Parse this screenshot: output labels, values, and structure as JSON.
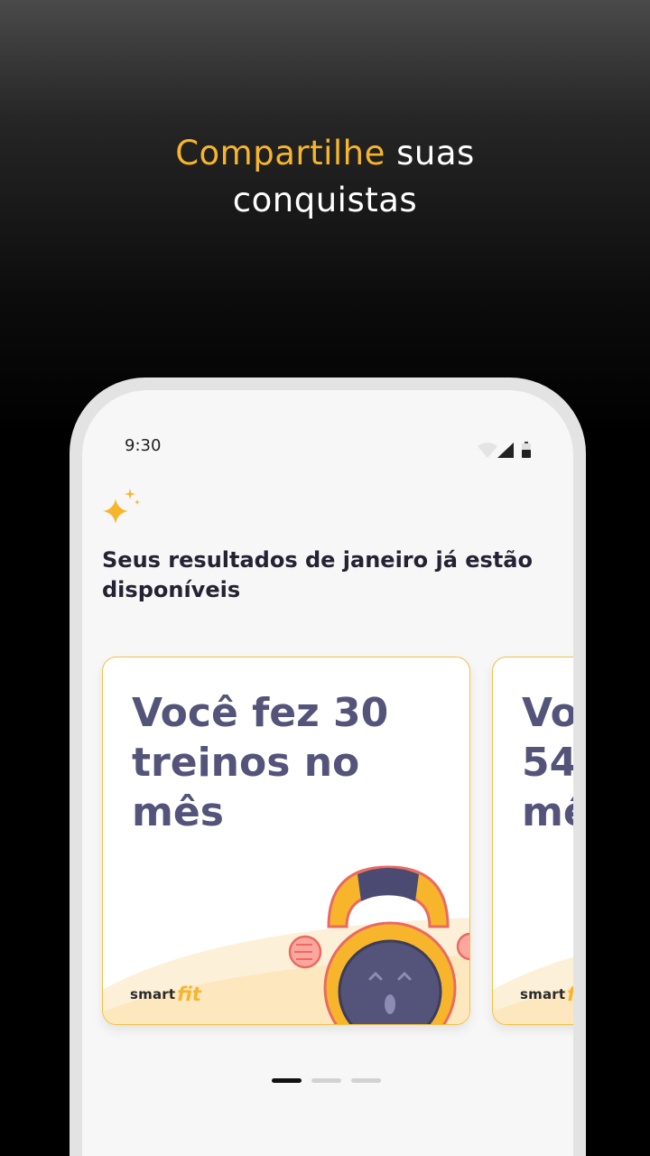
{
  "hero": {
    "accent": "Compartilhe",
    "rest_line1": " suas",
    "line2": "conquistas"
  },
  "status_bar": {
    "time": "9:30",
    "icons": [
      "wifi-icon",
      "signal-icon",
      "battery-icon"
    ]
  },
  "header": {
    "icon": "sparkle-icon",
    "title": "Seus resultados de janeiro já estão disponíveis"
  },
  "cards": [
    {
      "text_line1": "Você fez 30",
      "text_line2": "treinos no mês",
      "logo_smart": "smart",
      "logo_fit": "fit"
    },
    {
      "text_line1": "Vo",
      "text_line2": "54",
      "text_line3": "mê",
      "logo_smart": "smart",
      "logo_fit": "fit"
    }
  ],
  "pagination": {
    "count": 3,
    "active_index": 0
  },
  "colors": {
    "accent": "#f7b52c",
    "card_text": "#54547a",
    "card_border": "#f3c043",
    "title_text": "#232333"
  }
}
